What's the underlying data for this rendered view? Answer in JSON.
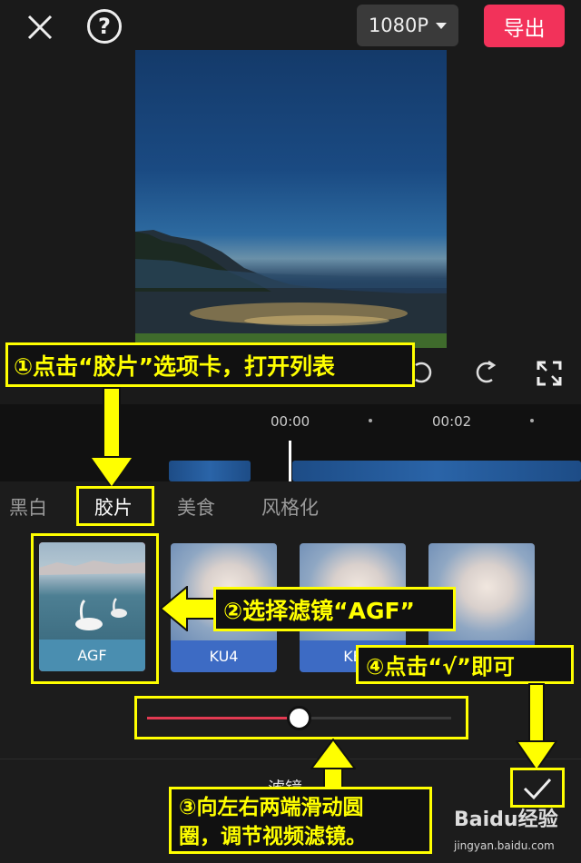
{
  "topbar": {
    "resolution_label": "1080P",
    "export_label": "导出",
    "help_glyph": "?"
  },
  "timeline": {
    "time_start": "00:00",
    "time_next": "00:02"
  },
  "filters": {
    "tabs": [
      {
        "label": "黑白"
      },
      {
        "label": "胶片"
      },
      {
        "label": "美食"
      },
      {
        "label": "风格化"
      }
    ],
    "items": [
      {
        "label": "AGF",
        "selected": true
      },
      {
        "label": "KU4"
      },
      {
        "label": "KE"
      },
      {
        "label": ""
      }
    ],
    "intensity": 0.5,
    "panel_title": "滤镜"
  },
  "annotations": {
    "step1": "①点击“胶片”选项卡，打开列表",
    "step2": "②选择滤镜“AGF”",
    "step3_line1": "③向左右两端滑动圆",
    "step3_line2": "圈，调节视频滤镜。",
    "step4": "④点击“√”即可"
  },
  "watermark": {
    "brand": "Baidu经验",
    "url": "jingyan.baidu.com"
  },
  "colors": {
    "accent": "#f2325a",
    "annotation": "#ffff00",
    "filter_caption": "#3d6bc4"
  }
}
